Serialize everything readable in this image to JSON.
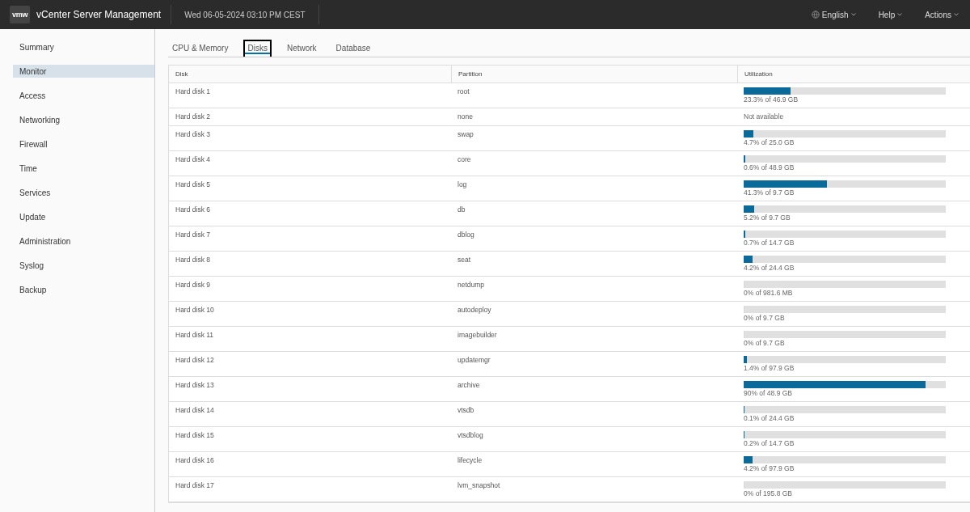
{
  "header": {
    "logo": "vmw",
    "title": "vCenter Server Management",
    "datetime": "Wed 06-05-2024 03:10 PM CEST",
    "menus": [
      {
        "label": "English",
        "kind": "language"
      },
      {
        "label": "Help",
        "kind": "plain"
      },
      {
        "label": "Actions",
        "kind": "plain"
      }
    ]
  },
  "sidebar": {
    "items": [
      {
        "label": "Summary",
        "selected": false
      },
      {
        "label": "Monitor",
        "selected": true
      },
      {
        "label": "Access",
        "selected": false
      },
      {
        "label": "Networking",
        "selected": false
      },
      {
        "label": "Firewall",
        "selected": false
      },
      {
        "label": "Time",
        "selected": false
      },
      {
        "label": "Services",
        "selected": false
      },
      {
        "label": "Update",
        "selected": false
      },
      {
        "label": "Administration",
        "selected": false
      },
      {
        "label": "Syslog",
        "selected": false
      },
      {
        "label": "Backup",
        "selected": false
      }
    ]
  },
  "tabs": [
    {
      "label": "CPU & Memory",
      "selected": false
    },
    {
      "label": "Disks",
      "selected": true
    },
    {
      "label": "Network",
      "selected": false
    },
    {
      "label": "Database",
      "selected": false
    }
  ],
  "table": {
    "columns": [
      "Disk",
      "Partition",
      "Utilization"
    ],
    "rows": [
      {
        "disk": "Hard disk 1",
        "partition": "root",
        "kind": "bar",
        "level": 0.233,
        "reading": "23.3% of 46.9 GB"
      },
      {
        "disk": "Hard disk 2",
        "partition": "none",
        "kind": "text",
        "reading": "Not available"
      },
      {
        "disk": "Hard disk 3",
        "partition": "swap",
        "kind": "bar",
        "level": 0.047,
        "reading": "4.7% of 25.0 GB"
      },
      {
        "disk": "Hard disk 4",
        "partition": "core",
        "kind": "bar",
        "level": 0.006,
        "reading": "0.6% of 48.9 GB"
      },
      {
        "disk": "Hard disk 5",
        "partition": "log",
        "kind": "bar",
        "level": 0.413,
        "reading": "41.3% of 9.7 GB"
      },
      {
        "disk": "Hard disk 6",
        "partition": "db",
        "kind": "bar",
        "level": 0.052,
        "reading": "5.2% of 9.7 GB"
      },
      {
        "disk": "Hard disk 7",
        "partition": "dblog",
        "kind": "bar",
        "level": 0.007,
        "reading": "0.7% of 14.7 GB"
      },
      {
        "disk": "Hard disk 8",
        "partition": "seat",
        "kind": "bar",
        "level": 0.042,
        "reading": "4.2% of 24.4 GB"
      },
      {
        "disk": "Hard disk 9",
        "partition": "netdump",
        "kind": "bar",
        "level": 0,
        "reading": "0% of 981.6 MB"
      },
      {
        "disk": "Hard disk 10",
        "partition": "autodeploy",
        "kind": "bar",
        "level": 0,
        "reading": "0% of 9.7 GB"
      },
      {
        "disk": "Hard disk 11",
        "partition": "imagebuilder",
        "kind": "bar",
        "level": 0,
        "reading": "0% of 9.7 GB"
      },
      {
        "disk": "Hard disk 12",
        "partition": "updatemgr",
        "kind": "bar",
        "level": 0.014,
        "reading": "1.4% of 97.9 GB"
      },
      {
        "disk": "Hard disk 13",
        "partition": "archive",
        "kind": "bar",
        "level": 0.9,
        "reading": "90% of 48.9 GB"
      },
      {
        "disk": "Hard disk 14",
        "partition": "vtsdb",
        "kind": "bar",
        "level": 0.001,
        "reading": "0.1% of 24.4 GB"
      },
      {
        "disk": "Hard disk 15",
        "partition": "vtsdblog",
        "kind": "bar",
        "level": 0.002,
        "reading": "0.2% of 14.7 GB"
      },
      {
        "disk": "Hard disk 16",
        "partition": "lifecycle",
        "kind": "bar",
        "level": 0.042,
        "reading": "4.2% of 97.9 GB"
      },
      {
        "disk": "Hard disk 17",
        "partition": "lvm_snapshot",
        "kind": "bar",
        "level": 0,
        "reading": "0% of 195.8 GB"
      }
    ]
  }
}
